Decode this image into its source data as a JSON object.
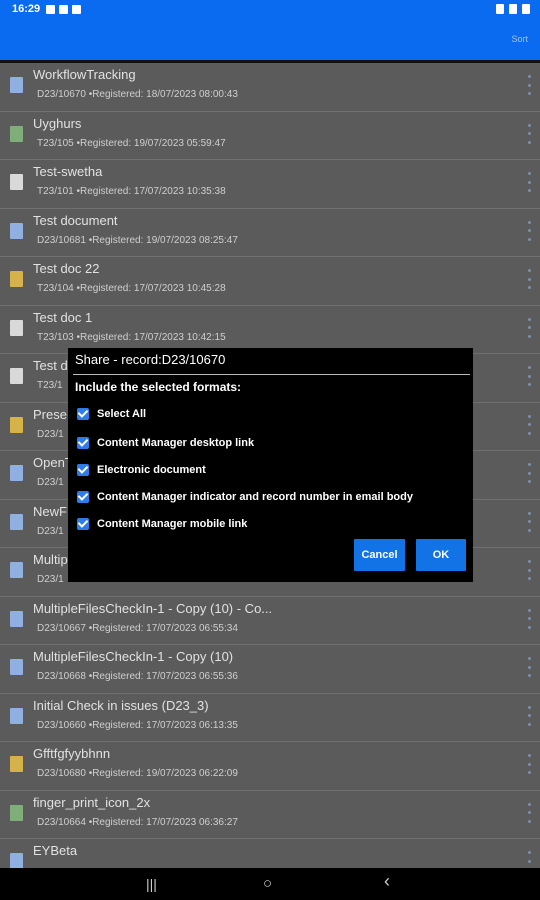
{
  "status_bar": {
    "time": "16:29"
  },
  "app_bar": {
    "sort_label": "Sort"
  },
  "records": [
    {
      "title": "WorkflowTracking",
      "meta": "D23/10670 •Registered: 18/07/2023 08:00:43",
      "icon": "ppt"
    },
    {
      "title": "Uyghurs",
      "meta": "T23/105 •Registered: 19/07/2023 05:59:47",
      "icon": "xls"
    },
    {
      "title": "Test-swetha",
      "meta": "T23/101 •Registered: 17/07/2023 10:35:38",
      "icon": "doc"
    },
    {
      "title": "Test document",
      "meta": "D23/10681 •Registered: 19/07/2023 08:25:47",
      "icon": "ppt"
    },
    {
      "title": "Test doc 22",
      "meta": "T23/104 •Registered: 17/07/2023 10:45:28",
      "icon": "img"
    },
    {
      "title": "Test doc 1",
      "meta": "T23/103 •Registered: 17/07/2023 10:42:15",
      "icon": "doc"
    },
    {
      "title": "Test d",
      "meta": "T23/1",
      "icon": "doc"
    },
    {
      "title": "Prese",
      "meta": "D23/1",
      "icon": "img"
    },
    {
      "title": "OpenT",
      "meta": "D23/1",
      "icon": "ppt"
    },
    {
      "title": "NewF",
      "meta": "D23/1",
      "icon": "ppt"
    },
    {
      "title": "Multip",
      "meta": "D23/1",
      "icon": "ppt"
    },
    {
      "title": "MultipleFilesCheckIn-1 - Copy (10) - Co...",
      "meta": "D23/10667 •Registered: 17/07/2023 06:55:34",
      "icon": "ppt"
    },
    {
      "title": "MultipleFilesCheckIn-1 - Copy (10)",
      "meta": "D23/10668 •Registered: 17/07/2023 06:55:36",
      "icon": "ppt"
    },
    {
      "title": "Initial Check in issues (D23_3)",
      "meta": "D23/10660 •Registered: 17/07/2023 06:13:35",
      "icon": "ppt"
    },
    {
      "title": "Gfftfgfyybhnn",
      "meta": "D23/10680 •Registered: 19/07/2023 06:22:09",
      "icon": "img"
    },
    {
      "title": "finger_print_icon_2x",
      "meta": "D23/10664 •Registered: 17/07/2023 06:36:27",
      "icon": "xls"
    },
    {
      "title": "EYBeta",
      "meta": "",
      "icon": "ppt"
    }
  ],
  "dialog": {
    "title": "Share - record:D23/10670",
    "subtitle": "Include the selected formats:",
    "options": [
      "Select All",
      "Content Manager desktop link",
      "Electronic document",
      "Content Manager indicator and record number in email body",
      "Content Manager mobile link"
    ],
    "cancel_label": "Cancel",
    "ok_label": "OK"
  },
  "nav_bar": {
    "recents": "|||",
    "home": "○",
    "back": "‹"
  }
}
